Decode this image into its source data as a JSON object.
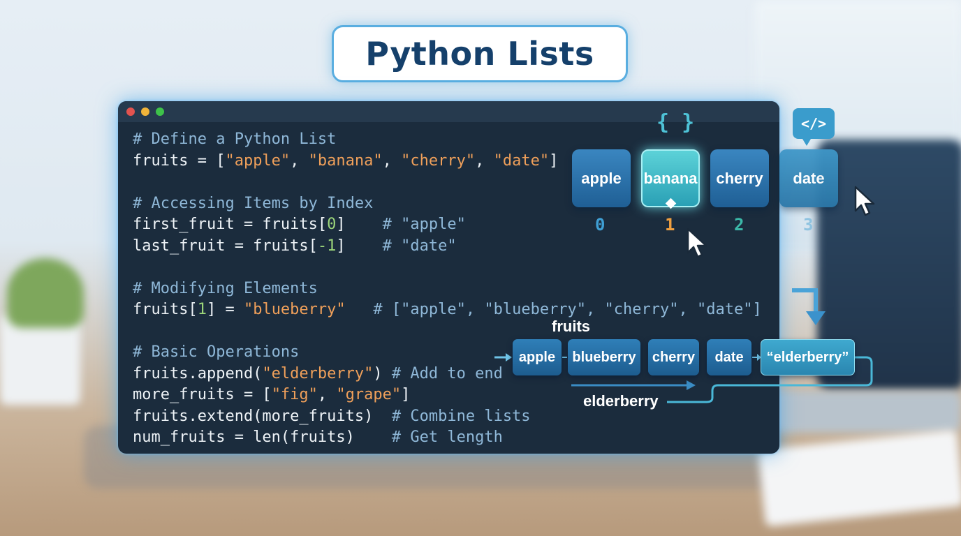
{
  "title": "Python Lists",
  "code_lines": [
    [
      {
        "t": "# Define a Python List",
        "c": "com"
      }
    ],
    [
      {
        "t": "fruits = [",
        "c": ""
      },
      {
        "t": "\"apple\"",
        "c": "str"
      },
      {
        "t": ", ",
        "c": ""
      },
      {
        "t": "\"banana\"",
        "c": "str"
      },
      {
        "t": ", ",
        "c": ""
      },
      {
        "t": "\"cherry\"",
        "c": "str"
      },
      {
        "t": ", ",
        "c": ""
      },
      {
        "t": "\"date\"",
        "c": "str"
      },
      {
        "t": "]",
        "c": ""
      }
    ],
    [
      {
        "t": "",
        "c": ""
      }
    ],
    [
      {
        "t": "# Accessing Items by Index",
        "c": "com"
      }
    ],
    [
      {
        "t": "first_fruit = fruits[",
        "c": ""
      },
      {
        "t": "0",
        "c": "num"
      },
      {
        "t": "]    ",
        "c": ""
      },
      {
        "t": "# \"apple\"",
        "c": "com"
      }
    ],
    [
      {
        "t": "last_fruit = fruits[",
        "c": ""
      },
      {
        "t": "-1",
        "c": "num"
      },
      {
        "t": "]    ",
        "c": ""
      },
      {
        "t": "# \"date\"",
        "c": "com"
      }
    ],
    [
      {
        "t": "",
        "c": ""
      }
    ],
    [
      {
        "t": "# Modifying Elements",
        "c": "com"
      }
    ],
    [
      {
        "t": "fruits[",
        "c": ""
      },
      {
        "t": "1",
        "c": "num"
      },
      {
        "t": "] = ",
        "c": ""
      },
      {
        "t": "\"blueberry\"",
        "c": "str"
      },
      {
        "t": "   ",
        "c": ""
      },
      {
        "t": "# [\"apple\", \"blueberry\", \"cherry\", \"date\"]",
        "c": "com"
      }
    ],
    [
      {
        "t": "",
        "c": ""
      }
    ],
    [
      {
        "t": "# Basic Operations",
        "c": "com"
      }
    ],
    [
      {
        "t": "fruits.append(",
        "c": ""
      },
      {
        "t": "\"elderberry\"",
        "c": "str"
      },
      {
        "t": ") ",
        "c": ""
      },
      {
        "t": "# Add to end",
        "c": "com"
      }
    ],
    [
      {
        "t": "more_fruits = [",
        "c": ""
      },
      {
        "t": "\"fig\"",
        "c": "str"
      },
      {
        "t": ", ",
        "c": ""
      },
      {
        "t": "\"grape\"",
        "c": "str"
      },
      {
        "t": "]",
        "c": ""
      }
    ],
    [
      {
        "t": "fruits.extend(more_fruits)  ",
        "c": ""
      },
      {
        "t": "# Combine lists",
        "c": "com"
      }
    ],
    [
      {
        "t": "num_fruits = len(fruits)    ",
        "c": ""
      },
      {
        "t": "# Get length",
        "c": "com"
      }
    ]
  ],
  "diagram": {
    "curly_icon": "{ }",
    "code_icon": "</>",
    "items": [
      "apple",
      "banana",
      "cherry",
      "date"
    ],
    "indexes": [
      "0",
      "1",
      "2",
      "3"
    ],
    "highlight_index": 1,
    "fruits_label": "fruits",
    "row_items": [
      "apple",
      "blueberry",
      "cherry",
      "date",
      "“elderberry”"
    ],
    "elder_label": "elderberry"
  },
  "colors": {
    "index_colors": [
      "#3f9fd4",
      "#f0a040",
      "#3bb8a8",
      "#8fc3e0"
    ]
  }
}
